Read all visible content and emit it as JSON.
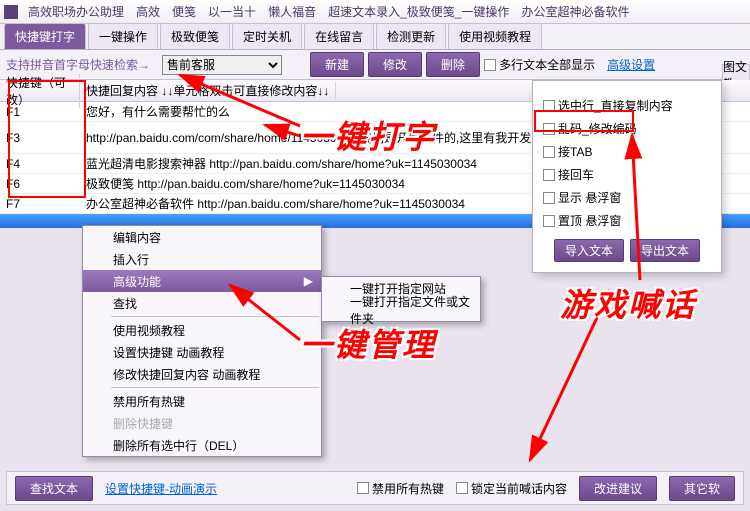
{
  "title_items": [
    "高效职场办公助理",
    "高效",
    "便笺",
    "以一当十",
    "懒人福音",
    "超速文本录入_极致便笺_一键操作",
    "办公室超神必备软件"
  ],
  "tabs": [
    "快捷键打字",
    "一键操作",
    "极致便笺",
    "定时关机",
    "在线留言",
    "检测更新",
    "使用视频教程"
  ],
  "toolbar": {
    "help": "支持拼音首字母快速检索→",
    "select": "售前客服",
    "new": "新建",
    "edit": "修改",
    "del": "删除",
    "chk_multi": "多行文本全部显示",
    "adv": "高级设置",
    "rt": "图文教"
  },
  "table": {
    "h_key": "快捷键（可改）",
    "h_val": "快捷回复内容 ↓↓单元格双击可直接修改内容↓↓",
    "rows": [
      {
        "k": "F1",
        "v": "您好，有什么需要帮忙的么"
      },
      {
        "k": "F3",
        "v": "http://pan.baidu.com/com/share/home/1145030034,我们是开发软件的,这里有我开发的一些软件"
      },
      {
        "k": "F4",
        "v": "蓝光超清电影搜索神器 http://pan.baidu.com/share/home?uk=1145030034"
      },
      {
        "k": "F6",
        "v": "极致便笺 http://pan.baidu.com/share/home?uk=1145030034"
      },
      {
        "k": "F7",
        "v": "办公室超神必备软件 http://pan.baidu.com/share/home?uk=1145030034"
      }
    ]
  },
  "ctx": {
    "edit": "编辑内容",
    "insert": "插入行",
    "adv": "高级功能",
    "find": "查找",
    "video": "使用视频教程",
    "s1": "设置快捷键 动画教程",
    "s2": "修改快捷回复内容 动画教程",
    "disable": "禁用所有热键",
    "delsel": "删除快捷键",
    "delall": "删除所有选中行（DEL）"
  },
  "sub": {
    "a": "一键打开指定网站",
    "b": "一键打开指定文件或文件夹"
  },
  "panel": {
    "c1": "选中行_直接复制内容",
    "c2": "乱码_修改编码",
    "c3": "接TAB",
    "c4": "接回车",
    "c5": "显示 悬浮窗",
    "c6": "置顶 悬浮窗",
    "imp": "导入文本",
    "exp": "导出文本"
  },
  "bottom": {
    "find": "查找文本",
    "set": "设置快捷键-动画演示",
    "chk1": "禁用所有热键",
    "chk2": "锁定当前喊话内容",
    "b1": "改进建议",
    "b2": "其它软"
  },
  "anno": {
    "a1": "一键打字",
    "a2": "一键管理",
    "a3": "游戏喊话"
  }
}
